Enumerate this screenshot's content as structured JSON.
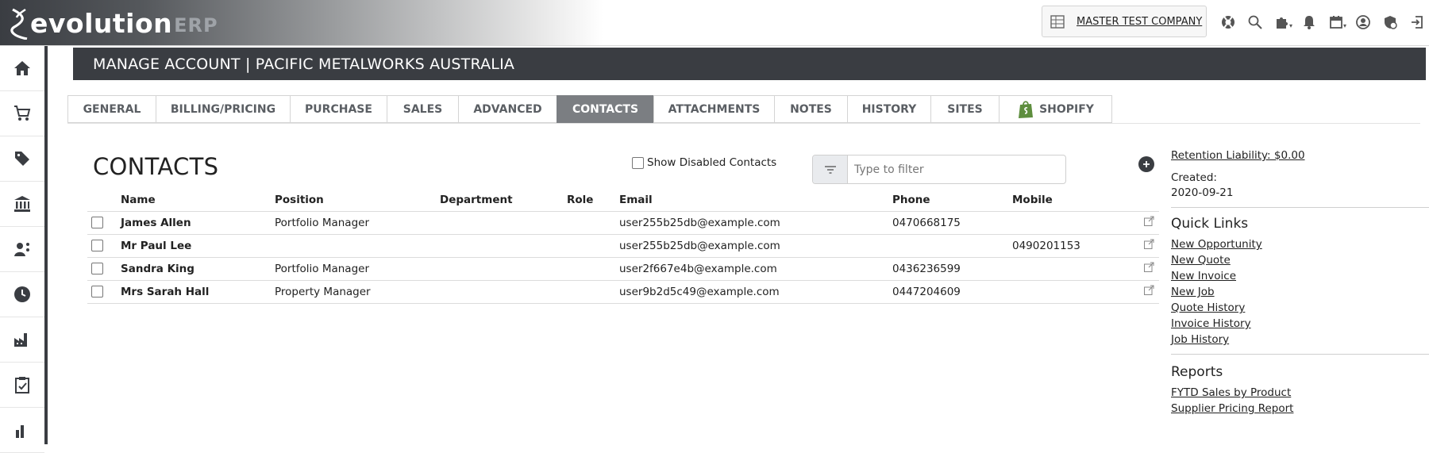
{
  "app": {
    "logo_text": "evolution",
    "logo_suffix": "ERP",
    "company": "MASTER TEST COMPANY"
  },
  "page_title": "MANAGE ACCOUNT | PACIFIC METALWORKS AUSTRALIA",
  "tabs": [
    {
      "label": "GENERAL"
    },
    {
      "label": "BILLING/PRICING"
    },
    {
      "label": "PURCHASE"
    },
    {
      "label": "SALES"
    },
    {
      "label": "ADVANCED"
    },
    {
      "label": "CONTACTS",
      "active": true
    },
    {
      "label": "ATTACHMENTS"
    },
    {
      "label": "NOTES"
    },
    {
      "label": "HISTORY"
    },
    {
      "label": "SITES"
    },
    {
      "label": "SHOPIFY"
    }
  ],
  "contacts": {
    "title": "CONTACTS",
    "show_disabled_label": "Show Disabled Contacts",
    "filter_placeholder": "Type to filter",
    "columns": [
      "Name",
      "Position",
      "Department",
      "Role",
      "Email",
      "Phone",
      "Mobile"
    ],
    "rows": [
      {
        "name": "James Allen",
        "position": "Portfolio Manager",
        "department": "",
        "role": "",
        "email": "user255b25db@example.com",
        "phone": "0470668175",
        "mobile": ""
      },
      {
        "name": "Mr Paul Lee",
        "position": "",
        "department": "",
        "role": "",
        "email": "user255b25db@example.com",
        "phone": "",
        "mobile": "0490201153"
      },
      {
        "name": "Sandra King",
        "position": "Portfolio Manager",
        "department": "",
        "role": "",
        "email": "user2f667e4b@example.com",
        "phone": "0436236599",
        "mobile": ""
      },
      {
        "name": "Mrs Sarah Hall",
        "position": "Property Manager",
        "department": "",
        "role": "",
        "email": "user9b2d5c49@example.com",
        "phone": "0447204609",
        "mobile": ""
      }
    ]
  },
  "right_panel": {
    "retention": "Retention Liability: $0.00",
    "created_label": "Created:",
    "created_value": "2020-09-21",
    "quick_links_title": "Quick Links",
    "quick_links": [
      "New Opportunity",
      "New Quote",
      "New Invoice",
      "New Job",
      "Quote History",
      "Invoice History",
      "Job History"
    ],
    "reports_title": "Reports",
    "reports": [
      "FYTD Sales by Product",
      "Supplier Pricing Report"
    ]
  },
  "colors": {
    "dark": "#3a3d42",
    "active_tab": "#7b7e82",
    "shopify_green": "#5e8e3e"
  }
}
